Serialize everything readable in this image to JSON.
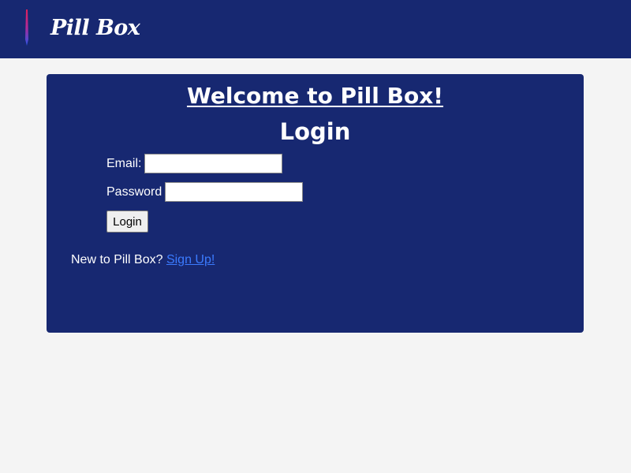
{
  "header": {
    "brand": "Pill Box",
    "logo_icon": "pen-icon"
  },
  "card": {
    "welcome_title": "Welcome to Pill Box!",
    "login_title": "Login",
    "email_label": "Email:",
    "email_value": "",
    "password_label": "Password",
    "password_value": "",
    "login_button": "Login",
    "signup_prompt": "New to Pill Box?",
    "signup_link": "Sign Up!"
  },
  "colors": {
    "navy": "#172871",
    "background": "#f4f4f4",
    "link": "#3b7bff"
  }
}
